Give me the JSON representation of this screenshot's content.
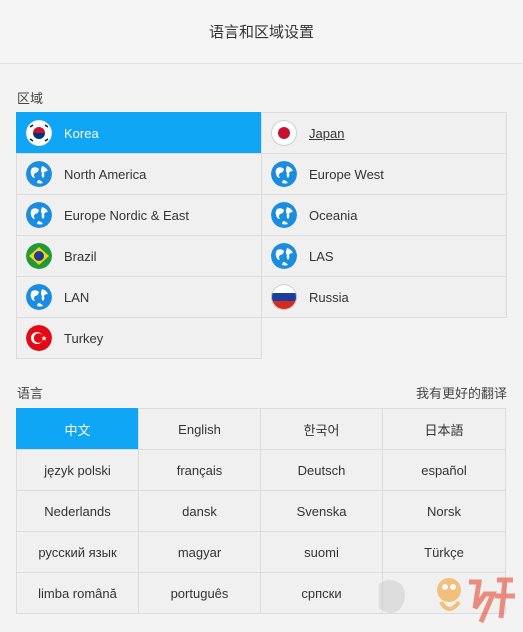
{
  "header": {
    "title": "语言和区域设置"
  },
  "region_section": {
    "label": "区域"
  },
  "regions": [
    {
      "name": "Korea",
      "icon": "korea-flag-icon",
      "selected": true
    },
    {
      "name": "Japan",
      "icon": "japan-flag-icon",
      "underline": true
    },
    {
      "name": "North America",
      "icon": "globe-icon"
    },
    {
      "name": "Europe West",
      "icon": "globe-icon"
    },
    {
      "name": "Europe Nordic & East",
      "icon": "globe-icon"
    },
    {
      "name": "Oceania",
      "icon": "globe-icon"
    },
    {
      "name": "Brazil",
      "icon": "brazil-flag-icon"
    },
    {
      "name": "LAS",
      "icon": "globe-icon"
    },
    {
      "name": "LAN",
      "icon": "globe-icon"
    },
    {
      "name": "Russia",
      "icon": "russia-flag-icon"
    },
    {
      "name": "Turkey",
      "icon": "turkey-flag-icon"
    }
  ],
  "language_section": {
    "label": "语言",
    "translate_link": "我有更好的翻译"
  },
  "languages": [
    {
      "name": "中文",
      "selected": true
    },
    {
      "name": "English"
    },
    {
      "name": "한국어"
    },
    {
      "name": "日本語"
    },
    {
      "name": "język polski"
    },
    {
      "name": "français"
    },
    {
      "name": "Deutsch"
    },
    {
      "name": "español"
    },
    {
      "name": "Nederlands"
    },
    {
      "name": "dansk"
    },
    {
      "name": "Svenska"
    },
    {
      "name": "Norsk"
    },
    {
      "name": "русский язык"
    },
    {
      "name": "magyar"
    },
    {
      "name": "suomi"
    },
    {
      "name": "Türkçe"
    },
    {
      "name": "limba română"
    },
    {
      "name": "português"
    },
    {
      "name": "српски"
    },
    {
      "name": ""
    }
  ],
  "colors": {
    "selected": "#0fa6f5",
    "cell": "#f0f0f0",
    "border": "#dcdcdc"
  }
}
